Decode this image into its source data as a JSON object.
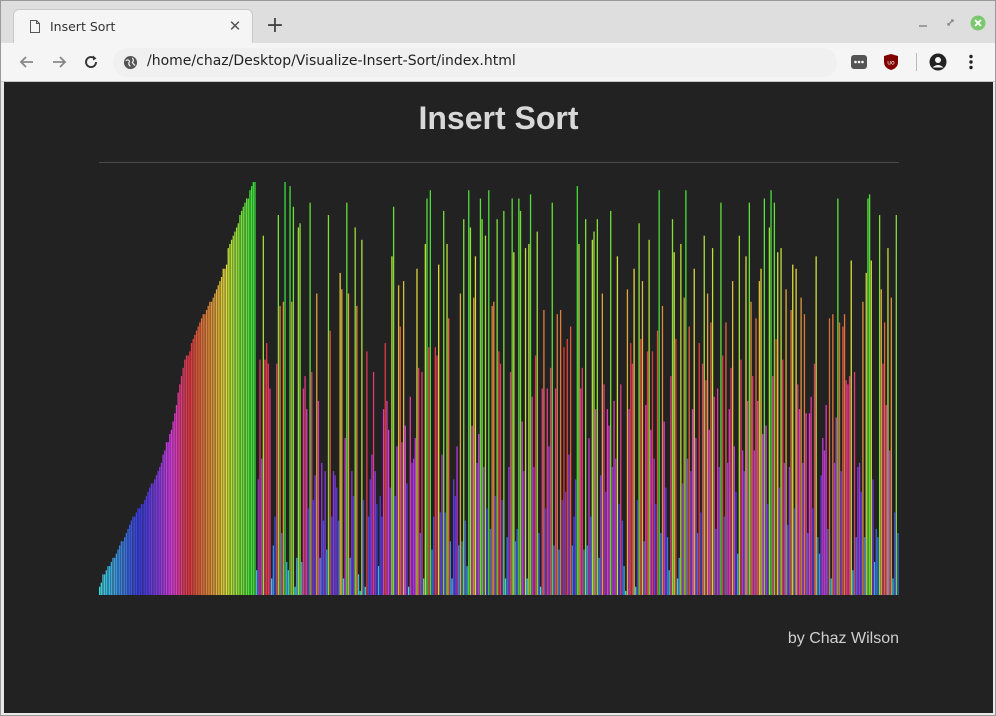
{
  "browser": {
    "tab_title": "Insert Sort",
    "url": "/home/chaz/Desktop/Visualize-Insert-Sort/index.html",
    "icons": {
      "tab": "document-icon",
      "close": "close-icon",
      "new_tab": "plus-icon",
      "back": "back-arrow-icon",
      "forward": "forward-arrow-icon",
      "reload": "reload-icon",
      "site_info": "globe-icon",
      "ext1": "chat-bubble-icon",
      "ext2": "ublock-icon",
      "profile": "profile-icon",
      "menu": "kebab-menu-icon"
    }
  },
  "page": {
    "title": "Insert Sort",
    "credit": "by Chaz Wilson",
    "background": "#222222"
  },
  "chart_data": {
    "type": "bar",
    "title": "Insert Sort",
    "xlabel": "",
    "ylabel": "",
    "ylim": [
      0,
      100
    ],
    "color_scheme": "hue-mapped by value (teal → blue → purple → magenta → red → orange → yellow → green)",
    "values": [
      2,
      3,
      5,
      5,
      6,
      7,
      7,
      8,
      9,
      9,
      10,
      11,
      12,
      13,
      13,
      14,
      15,
      16,
      17,
      18,
      19,
      19,
      20,
      21,
      21,
      22,
      22,
      23,
      24,
      25,
      26,
      27,
      27,
      28,
      29,
      30,
      31,
      32,
      34,
      35,
      37,
      37,
      39,
      40,
      42,
      44,
      46,
      49,
      51,
      53,
      55,
      57,
      58,
      58,
      59,
      61,
      62,
      63,
      64,
      65,
      66,
      67,
      68,
      68,
      69,
      70,
      71,
      71,
      72,
      73,
      74,
      75,
      76,
      77,
      79,
      79,
      80,
      84,
      85,
      86,
      87,
      88,
      89,
      90,
      92,
      93,
      94,
      95,
      96,
      96,
      98,
      99,
      100,
      100,
      6,
      28,
      57,
      33,
      87,
      57,
      61,
      56,
      50,
      4,
      12,
      19,
      56,
      92,
      70,
      15,
      71,
      100,
      8,
      6,
      99,
      71,
      94,
      2,
      9,
      89,
      90,
      8,
      50,
      53,
      45,
      21,
      95,
      54,
      23,
      29,
      73,
      47,
      9,
      32,
      18,
      30,
      11,
      92,
      64,
      19,
      30,
      29,
      26,
      18,
      78,
      74,
      4,
      38,
      95,
      73,
      9,
      30,
      24,
      89,
      70,
      5,
      1,
      86,
      23,
      2,
      59,
      19,
      28,
      34,
      54,
      30,
      22,
      7,
      24,
      19,
      45,
      61,
      47,
      40,
      26,
      82,
      94,
      24,
      36,
      75,
      65,
      37,
      76,
      41,
      27,
      2,
      48,
      32,
      33,
      38,
      79,
      55,
      15,
      54,
      4,
      85,
      96,
      60,
      98,
      11,
      19,
      60,
      58,
      80,
      20,
      34,
      93,
      20,
      85,
      67,
      13,
      4,
      28,
      24,
      36,
      12,
      73,
      13,
      91,
      18,
      7,
      98,
      89,
      41,
      72,
      82,
      32,
      39,
      96,
      91,
      31,
      87,
      21,
      98,
      16,
      70,
      71,
      24,
      91,
      59,
      56,
      23,
      93,
      4,
      14,
      31,
      54,
      96,
      83,
      13,
      16,
      96,
      93,
      42,
      30,
      84,
      4,
      85,
      97,
      48,
      31,
      58,
      88,
      15,
      2,
      50,
      69,
      21,
      50,
      36,
      55,
      95,
      12,
      50,
      68,
      11,
      69,
      23,
      60,
      25,
      62,
      34,
      65,
      12,
      19,
      28,
      99,
      85,
      50,
      55,
      11,
      91,
      12,
      38,
      19,
      86,
      88,
      45,
      91,
      9,
      29,
      73,
      51,
      25,
      45,
      41,
      93,
      31,
      47,
      33,
      82,
      22,
      51,
      18,
      7,
      1,
      74,
      45,
      61,
      56,
      79,
      2,
      23,
      90,
      62,
      76,
      13,
      46,
      59,
      86,
      40,
      59,
      33,
      22,
      64,
      98,
      15,
      70,
      42,
      26,
      14,
      6,
      53,
      91,
      83,
      62,
      4,
      9,
      85,
      27,
      72,
      98,
      33,
      65,
      30,
      45,
      79,
      38,
      15,
      61,
      20,
      56,
      87,
      52,
      73,
      40,
      66,
      84,
      48,
      16,
      50,
      31,
      95,
      58,
      19,
      66,
      32,
      45,
      55,
      76,
      36,
      25,
      10,
      87,
      57,
      35,
      30,
      82,
      47,
      95,
      71,
      53,
      35,
      67,
      47,
      76,
      79,
      39,
      96,
      41,
      22,
      89,
      98,
      53,
      95,
      62,
      83,
      26,
      84,
      57,
      32,
      74,
      17,
      31,
      69,
      80,
      21,
      79,
      51,
      45,
      72,
      32,
      68,
      44,
      15,
      44,
      48,
      21,
      56,
      82,
      14,
      10,
      29,
      38,
      35,
      46,
      16,
      67,
      4,
      68,
      32,
      43,
      96,
      66,
      30,
      65,
      68,
      52,
      51,
      53,
      81,
      6,
      54,
      14,
      31,
      32,
      25,
      71,
      14,
      78,
      96,
      97,
      81,
      28,
      8,
      16,
      14,
      92,
      74,
      56,
      66,
      46,
      84,
      35,
      72,
      4,
      20,
      92,
      15
    ]
  }
}
